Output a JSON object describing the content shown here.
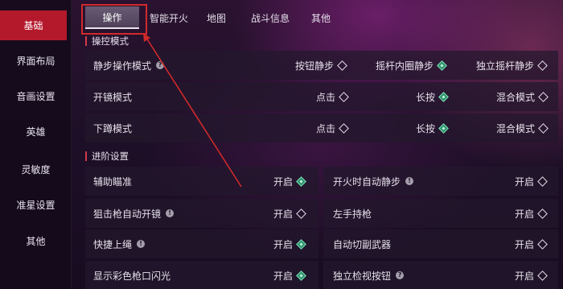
{
  "sidebar": {
    "items": [
      {
        "label": "基础",
        "active": true
      },
      {
        "label": "界面布局"
      },
      {
        "label": "音画设置"
      },
      {
        "label": "英雄"
      },
      {
        "label": "灵敏度"
      },
      {
        "label": "准星设置"
      },
      {
        "label": "其他"
      }
    ]
  },
  "tabs": [
    {
      "label": "操作",
      "active": true
    },
    {
      "label": "智能开火"
    },
    {
      "label": "地图"
    },
    {
      "label": "战斗信息"
    },
    {
      "label": "其他"
    }
  ],
  "control_mode": {
    "title": "操控模式",
    "rows": [
      {
        "label": "静步操作模式",
        "options": [
          "按钮静步",
          "摇杆内圈静步",
          "独立摇杆静步"
        ],
        "selected": 1
      },
      {
        "label": "开镜模式",
        "options": [
          "点击",
          "长按",
          "混合模式"
        ],
        "selected": 1
      },
      {
        "label": "下蹲模式",
        "options": [
          "点击",
          "长按",
          "混合模式"
        ],
        "selected": 1
      }
    ]
  },
  "advanced": {
    "title": "进阶设置",
    "toggle_label": "开启",
    "items": [
      {
        "label": "辅助瞄准",
        "on": true
      },
      {
        "label": "开火时自动静步",
        "on": false
      },
      {
        "label": "狙击枪自动开镜",
        "on": false
      },
      {
        "label": "左手持枪",
        "on": false
      },
      {
        "label": "快捷上绳",
        "on": true
      },
      {
        "label": "自动切副武器",
        "on": false
      },
      {
        "label": "显示彩色枪口闪光",
        "on": true
      },
      {
        "label": "独立检视按钮",
        "on": false
      }
    ]
  },
  "colors": {
    "accent_red": "#b4192b",
    "toggle_on": "#2e8f6a",
    "annotation": "#d02a2a"
  }
}
